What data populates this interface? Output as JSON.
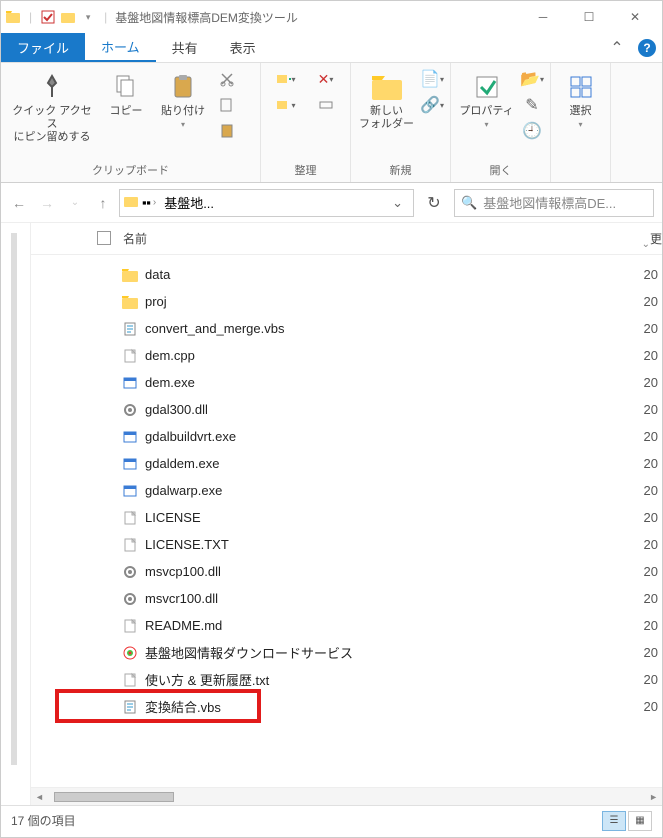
{
  "window": {
    "title": "基盤地図情報標高DEM変換ツール"
  },
  "tabs": {
    "file": "ファイル",
    "home": "ホーム",
    "share": "共有",
    "view": "表示"
  },
  "ribbon": {
    "quick_access": "クイック アクセス\nにピン留めする",
    "copy": "コピー",
    "paste": "貼り付け",
    "clipboard_group": "クリップボード",
    "organize_group": "整理",
    "new_folder": "新しい\nフォルダー",
    "new_group": "新規",
    "properties": "プロパティ",
    "open_group": "開く",
    "select": "選択",
    "select_group": ""
  },
  "nav": {
    "breadcrumb_seg": "基盤地...",
    "search_placeholder": "基盤地図情報標高DE..."
  },
  "columns": {
    "name": "名前",
    "date": "更"
  },
  "files": [
    {
      "name": "data",
      "type": "folder",
      "date": "20"
    },
    {
      "name": "proj",
      "type": "folder",
      "date": "20"
    },
    {
      "name": "convert_and_merge.vbs",
      "type": "vbs",
      "date": "20"
    },
    {
      "name": "dem.cpp",
      "type": "txt",
      "date": "20"
    },
    {
      "name": "dem.exe",
      "type": "exe",
      "date": "20"
    },
    {
      "name": "gdal300.dll",
      "type": "dll",
      "date": "20"
    },
    {
      "name": "gdalbuildvrt.exe",
      "type": "exe",
      "date": "20"
    },
    {
      "name": "gdaldem.exe",
      "type": "exe",
      "date": "20"
    },
    {
      "name": "gdalwarp.exe",
      "type": "exe",
      "date": "20"
    },
    {
      "name": "LICENSE",
      "type": "txt",
      "date": "20"
    },
    {
      "name": "LICENSE.TXT",
      "type": "txt",
      "date": "20"
    },
    {
      "name": "msvcp100.dll",
      "type": "dll",
      "date": "20"
    },
    {
      "name": "msvcr100.dll",
      "type": "dll",
      "date": "20"
    },
    {
      "name": "README.md",
      "type": "txt",
      "date": "20"
    },
    {
      "name": "基盤地図情報ダウンロードサービス",
      "type": "url",
      "date": "20"
    },
    {
      "name": "使い方 & 更新履歴.txt",
      "type": "txt",
      "date": "20"
    },
    {
      "name": "変換結合.vbs",
      "type": "vbs",
      "date": "20",
      "highlighted": true
    }
  ],
  "status": {
    "item_count": "17 個の項目"
  }
}
